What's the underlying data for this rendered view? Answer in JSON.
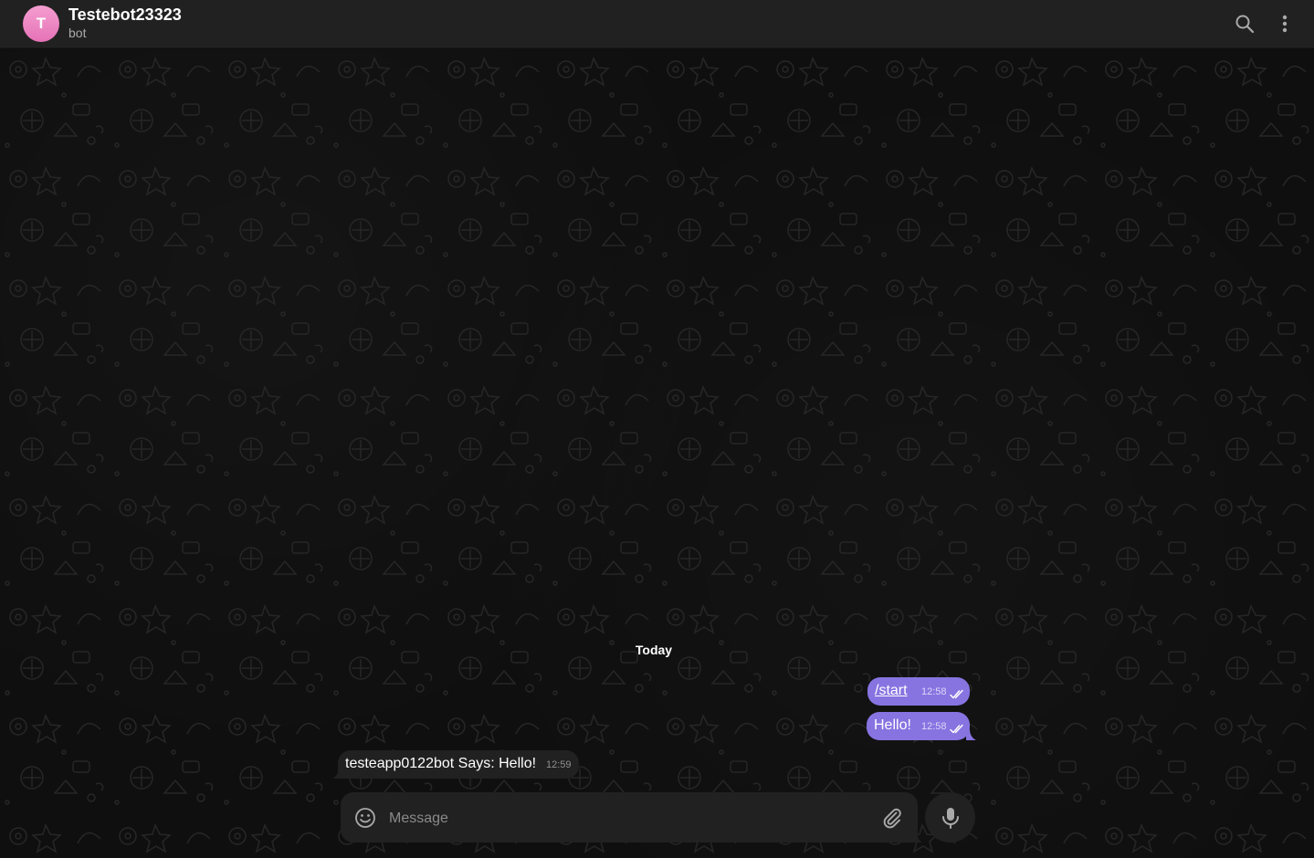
{
  "header": {
    "avatar_letter": "T",
    "title": "Testebot23323",
    "status": "bot",
    "search_icon": "search-icon",
    "more_icon": "more-vertical-icon"
  },
  "chat": {
    "date_separator": "Today",
    "messages": [
      {
        "direction": "out",
        "text": "/start",
        "time": "12:58",
        "status": "read"
      },
      {
        "direction": "out",
        "text": "Hello!",
        "time": "12:58",
        "status": "read"
      },
      {
        "direction": "in",
        "text": "testeapp0122bot Says: Hello!",
        "time": "12:59"
      }
    ]
  },
  "composer": {
    "placeholder": "Message",
    "value": "",
    "emoji_icon": "emoji-icon",
    "attach_icon": "paperclip-icon",
    "mic_icon": "microphone-icon"
  },
  "colors": {
    "accent": "#8774e1",
    "header_bg": "#212121",
    "chat_bg": "#0f0f0f",
    "incoming_bubble": "#212121",
    "avatar": "#ee86c4"
  }
}
